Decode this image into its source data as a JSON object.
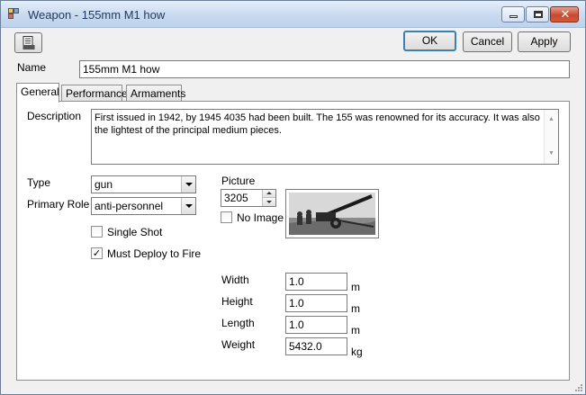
{
  "window": {
    "title": "Weapon - 155mm M1 how"
  },
  "toolbar": {
    "ok_label": "OK",
    "cancel_label": "Cancel",
    "apply_label": "Apply"
  },
  "name_field": {
    "label": "Name",
    "value": "155mm M1 how"
  },
  "tabs": [
    {
      "label": "General",
      "active": true
    },
    {
      "label": "Performance",
      "active": false
    },
    {
      "label": "Armaments",
      "active": false
    }
  ],
  "general": {
    "description_label": "Description",
    "description": "First issued in 1942, by 1945 4035 had been built.  The 155 was renowned for its accuracy.  It was also the lightest of the principal medium pieces.",
    "type_label": "Type",
    "type_value": "gun",
    "role_label": "Primary Role",
    "role_value": "anti-personnel",
    "single_shot_label": "Single Shot",
    "single_shot_checked": false,
    "must_deploy_label": "Must Deploy to Fire",
    "must_deploy_checked": true,
    "picture_label": "Picture",
    "picture_number": "3205",
    "no_image_label": "No Image",
    "no_image_checked": false,
    "width_label": "Width",
    "width_value": "1.0",
    "width_unit": "m",
    "height_label": "Height",
    "height_value": "1.0",
    "height_unit": "m",
    "length_label": "Length",
    "length_value": "1.0",
    "length_unit": "m",
    "weight_label": "Weight",
    "weight_value": "5432.0",
    "weight_unit": "kg"
  },
  "colors": {
    "default_button_border": "#3c7fb1",
    "close_button": "#c74a2f"
  }
}
